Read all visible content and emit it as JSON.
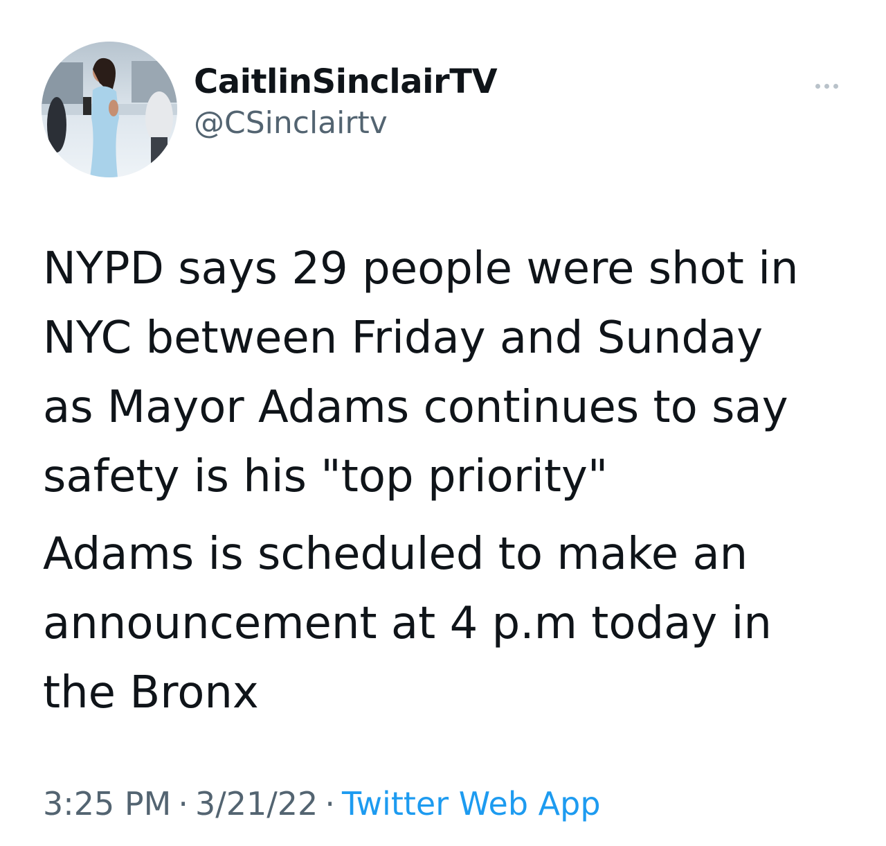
{
  "author": {
    "display_name": "CaitlinSinclairTV",
    "handle": "@CSinclairtv",
    "avatar_icon": "profile-photo"
  },
  "more_icon": "more-horizontal-icon",
  "tweet": {
    "paragraphs": [
      "NYPD says 29 people were shot in\nNYC between Friday and Sunday\nas Mayor Adams continues to say\nsafety is his \"top priority\"",
      "Adams is scheduled to make an\nannouncement at 4 p.m today in\nthe Bronx"
    ]
  },
  "meta": {
    "time": "3:25 PM",
    "separator": "·",
    "date": "3/21/22",
    "source": "Twitter Web App"
  },
  "colors": {
    "text": "#0f1419",
    "secondary": "#536471",
    "link": "#1d9bf0"
  }
}
